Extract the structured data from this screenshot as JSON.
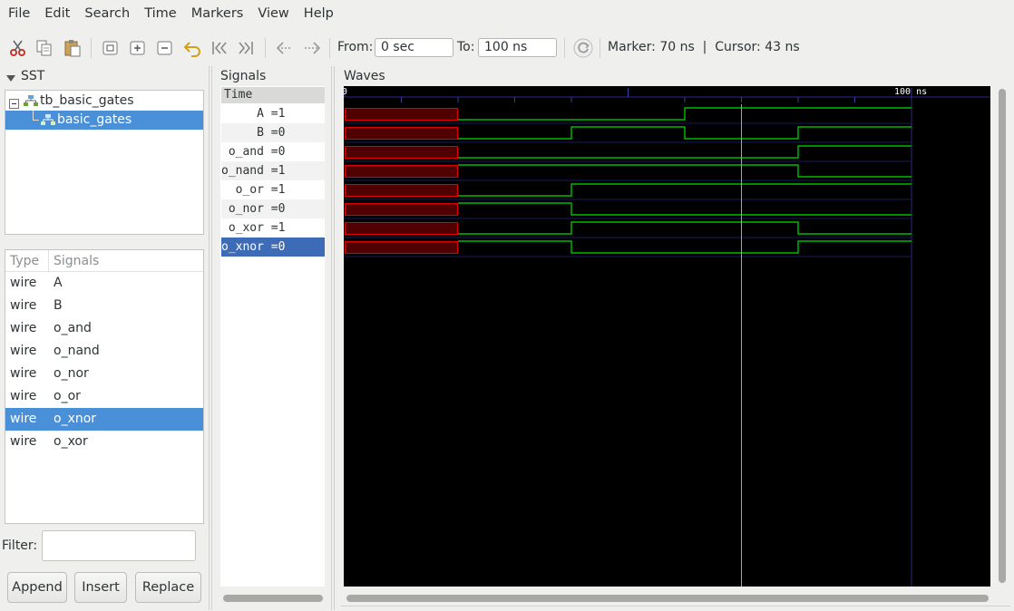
{
  "menu": [
    "File",
    "Edit",
    "Search",
    "Time",
    "Markers",
    "View",
    "Help"
  ],
  "toolbar": {
    "icons": [
      "cut-icon",
      "copy-icon",
      "paste-icon",
      "zoom-fit-icon",
      "zoom-in-icon",
      "zoom-out-icon",
      "undo-icon",
      "zoom-start-icon",
      "zoom-end-icon",
      "prev-edge-icon",
      "next-edge-icon",
      "reload-icon"
    ],
    "from_label": "From:",
    "from_value": "0 sec",
    "to_label": "To:",
    "to_value": "100 ns",
    "marker_text": "Marker: 70 ns  |  Cursor: 43 ns"
  },
  "sst": {
    "title": "SST",
    "tree": [
      {
        "label": "tb_basic_gates",
        "selected": false
      },
      {
        "label": "basic_gates",
        "selected": true
      }
    ],
    "columns": {
      "type": "Type",
      "signals": "Signals"
    },
    "rows": [
      {
        "type": "wire",
        "name": "A",
        "selected": false
      },
      {
        "type": "wire",
        "name": "B",
        "selected": false
      },
      {
        "type": "wire",
        "name": "o_and",
        "selected": false
      },
      {
        "type": "wire",
        "name": "o_nand",
        "selected": false
      },
      {
        "type": "wire",
        "name": "o_nor",
        "selected": false
      },
      {
        "type": "wire",
        "name": "o_or",
        "selected": false
      },
      {
        "type": "wire",
        "name": "o_xnor",
        "selected": true
      },
      {
        "type": "wire",
        "name": "o_xor",
        "selected": false
      }
    ],
    "filter_label": "Filter:",
    "filter_value": "",
    "buttons": [
      "Append",
      "Insert",
      "Replace"
    ]
  },
  "signals_panel": {
    "title": "Signals",
    "time_header": "Time",
    "rows": [
      {
        "text": "     A =1",
        "selected": false
      },
      {
        "text": "     B =0",
        "selected": false
      },
      {
        "text": " o_and =0",
        "selected": false
      },
      {
        "text": "o_nand =1",
        "selected": false
      },
      {
        "text": "  o_or =1",
        "selected": false
      },
      {
        "text": " o_nor =0",
        "selected": false
      },
      {
        "text": " o_xor =1",
        "selected": false
      },
      {
        "text": "o_xnor =0",
        "selected": true
      }
    ]
  },
  "waves_panel": {
    "title": "Waves",
    "ruler_start": "0",
    "ruler_end": "100 ns",
    "time_end_ns": 100,
    "cursor_ns": 70,
    "undefined_until_ns": 20,
    "colors": {
      "background": "#000000",
      "wave": "#00e000",
      "undefined": "#e00000",
      "undefined_fill": "#500000",
      "cursor": "#ff8080",
      "grid": "#1a1a5a"
    },
    "signals": [
      {
        "name": "A",
        "transitions": [
          [
            20,
            0
          ],
          [
            60,
            1
          ]
        ]
      },
      {
        "name": "B",
        "transitions": [
          [
            20,
            0
          ],
          [
            40,
            1
          ],
          [
            60,
            0
          ],
          [
            80,
            1
          ]
        ]
      },
      {
        "name": "o_and",
        "transitions": [
          [
            20,
            0
          ],
          [
            80,
            1
          ]
        ]
      },
      {
        "name": "o_nand",
        "transitions": [
          [
            20,
            1
          ],
          [
            80,
            0
          ]
        ]
      },
      {
        "name": "o_or",
        "transitions": [
          [
            20,
            0
          ],
          [
            40,
            1
          ],
          [
            80,
            1
          ]
        ]
      },
      {
        "name": "o_nor",
        "transitions": [
          [
            20,
            1
          ],
          [
            40,
            0
          ],
          [
            80,
            0
          ]
        ]
      },
      {
        "name": "o_xor",
        "transitions": [
          [
            20,
            0
          ],
          [
            40,
            1
          ],
          [
            80,
            0
          ]
        ]
      },
      {
        "name": "o_xnor",
        "transitions": [
          [
            20,
            1
          ],
          [
            40,
            0
          ],
          [
            80,
            1
          ]
        ]
      }
    ]
  }
}
